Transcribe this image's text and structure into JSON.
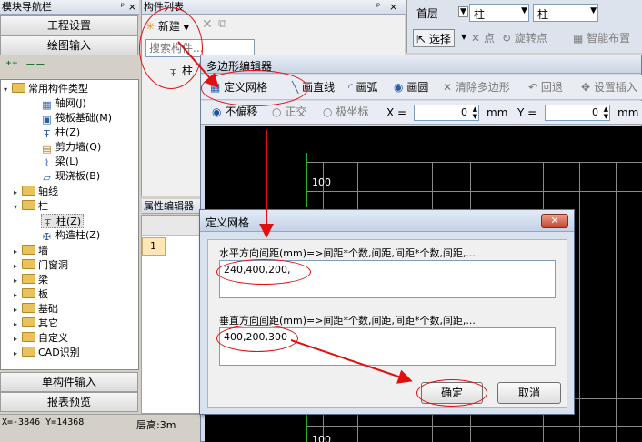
{
  "nav": {
    "title": "模块导航栏",
    "pin": "ᵖ",
    "close": "×",
    "btn_project": "工程设置",
    "btn_drawing": "绘图输入",
    "btn_single": "单构件输入",
    "btn_report": "报表预览",
    "tree": {
      "root": "常用构件类型",
      "common": [
        "轴网(J)",
        "筏板基础(M)",
        "柱(Z)",
        "剪力墙(Q)",
        "梁(L)",
        "现浇板(B)"
      ],
      "axis": "轴线",
      "column": "柱",
      "column_items": [
        "柱(Z)",
        "构造柱(Z)"
      ],
      "others": [
        "墙",
        "门窗洞",
        "梁",
        "板",
        "基础",
        "其它",
        "自定义",
        "CAD识别"
      ]
    }
  },
  "status": {
    "coords": "X=-3846 Y=14368",
    "floor_height": "层高:3m"
  },
  "complist": {
    "title": "构件列表",
    "new_label": "新建",
    "search_placeholder": "搜索构件...",
    "item": "柱"
  },
  "props": {
    "title": "属性编辑器",
    "row_num": "1"
  },
  "toolbar": {
    "floor": "首层",
    "type": "柱",
    "name": "柱",
    "select": "选择",
    "point": "点",
    "rotate": "旋转点",
    "smart": "智能布置"
  },
  "poly_editor": {
    "title": "多边形编辑器",
    "define_grid": "定义网格",
    "draw_line": "画直线",
    "draw_arc": "画弧",
    "draw_circle": "画圆",
    "clear": "清除多边形",
    "undo": "回退",
    "set_insert": "设置插入",
    "no_offset": "不偏移",
    "orthogonal": "正交",
    "polar": "极坐标",
    "x_label": "X =",
    "x_value": "0",
    "y_label": "Y =",
    "y_value": "0",
    "unit": "mm",
    "grid_label_100": "100",
    "grid_label_bottom": "100"
  },
  "dialog": {
    "title": "定义网格",
    "h_label": "水平方向间距(mm)=>间距*个数,间距,间距*个数,间距,...",
    "h_value": "240,400,200,",
    "v_label": "垂直方向间距(mm)=>间距*个数,间距,间距*个数,间距,...",
    "v_value": "400,200,300",
    "ok": "确定",
    "cancel": "取消"
  }
}
